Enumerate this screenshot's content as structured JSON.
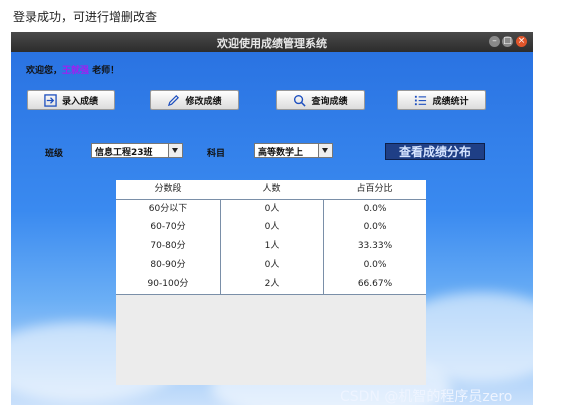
{
  "caption": "登录成功，可进行增删改查",
  "window": {
    "title": "欢迎使用成绩管理系统"
  },
  "welcome": {
    "prefix": "欢迎您，",
    "name": "王就强",
    "suffix": " 老师！"
  },
  "toolbar": {
    "enter_label": "录入成绩",
    "modify_label": "修改成绩",
    "query_label": "查询成绩",
    "stats_label": "成绩统计"
  },
  "filters": {
    "class_label": "班级",
    "class_value": "信息工程23班",
    "subject_label": "科目",
    "subject_value": "高等数学上"
  },
  "distribution_button": "查看成绩分布",
  "table": {
    "headers": [
      "分数段",
      "人数",
      "占百分比"
    ],
    "rows": [
      [
        "60分以下",
        "0人",
        "0.0%"
      ],
      [
        "60-70分",
        "0人",
        "0.0%"
      ],
      [
        "70-80分",
        "1人",
        "33.33%"
      ],
      [
        "80-90分",
        "0人",
        "0.0%"
      ],
      [
        "90-100分",
        "2人",
        "66.67%"
      ]
    ]
  },
  "watermark": "CSDN @机智的程序员zero",
  "colors": {
    "window_bg": "#2f7fe6",
    "titlebar": "#3a3a3a",
    "close_button": "#e0552a",
    "teacher_name": "#a020f0",
    "distribution_button_bg": "#1f3f86"
  }
}
